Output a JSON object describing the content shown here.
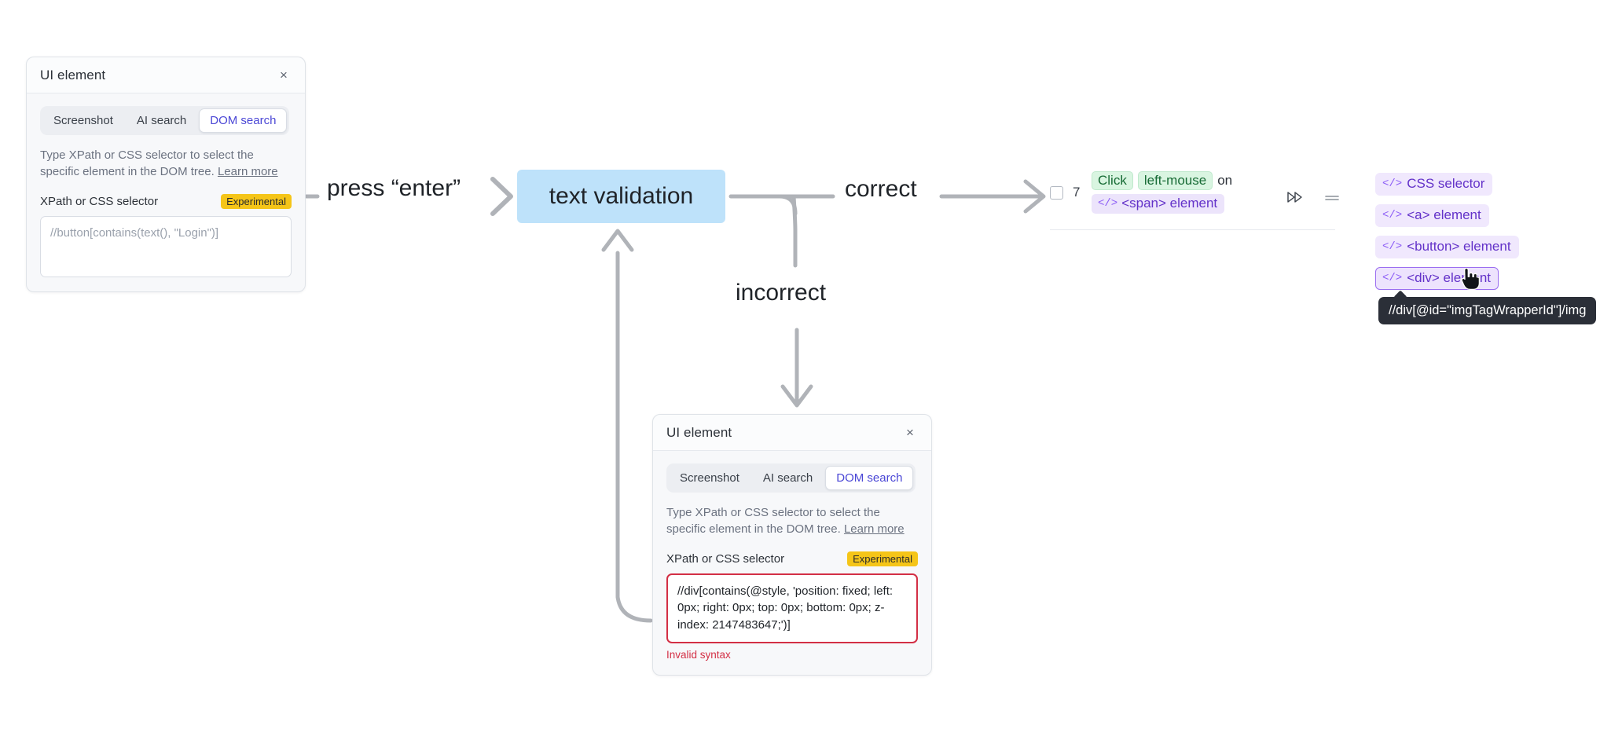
{
  "panel_one": {
    "title": "UI element",
    "close_label": "×",
    "tabs": [
      {
        "label": "Screenshot",
        "active": false
      },
      {
        "label": "AI search",
        "active": false
      },
      {
        "label": "DOM search",
        "active": true
      }
    ],
    "hint_text": "Type XPath or CSS selector to select the specific element in the DOM tree. ",
    "hint_link": "Learn more",
    "field_label": "XPath or CSS selector",
    "experimental_badge": "Experimental",
    "selector_placeholder": "//button[contains(text(), \"Login\")]",
    "selector_value": ""
  },
  "panel_two": {
    "title": "UI element",
    "close_label": "×",
    "tabs": [
      {
        "label": "Screenshot",
        "active": false
      },
      {
        "label": "AI search",
        "active": false
      },
      {
        "label": "DOM search",
        "active": true
      }
    ],
    "hint_text": "Type XPath or CSS selector to select the specific element in the DOM tree. ",
    "hint_link": "Learn more",
    "field_label": "XPath or CSS selector",
    "experimental_badge": "Experimental",
    "selector_value": "//div[contains(@style, 'position: fixed; left: 0px; right: 0px; top: 0px; bottom: 0px; z-index: 2147483647;')]",
    "error_message": "Invalid syntax"
  },
  "flow": {
    "press_enter_label": "press “enter”",
    "node_label": "text validation",
    "correct_label": "correct",
    "incorrect_label": "incorrect"
  },
  "action_row": {
    "index": "7",
    "checkbox_checked": false,
    "verb_chip": "Click",
    "button_chip": "left-mouse",
    "connector_word": "on",
    "target_chip": "<span> element",
    "code_glyph": "</>",
    "run_icon": "run-from-here-icon",
    "drag_icon": "drag-handle-icon"
  },
  "suggestions": {
    "code_glyph": "</>",
    "items": [
      {
        "label": "CSS selector",
        "hovered": false
      },
      {
        "label": "<a> element",
        "hovered": false
      },
      {
        "label": "<button> element",
        "hovered": false
      },
      {
        "label": "<div> element",
        "hovered": true
      }
    ]
  },
  "tooltip": {
    "text": "//div[@id=\"imgTagWrapperId\"]/img"
  },
  "colors": {
    "node_blue": "#bee2fa",
    "accent_purple": "#6332c9",
    "chip_green_bg": "#d9f5e1",
    "error_red": "#d32f45",
    "experimental_yellow": "#f5c518",
    "connector_gray": "#b0b3b8",
    "tooltip_bg": "#2b2f38"
  }
}
